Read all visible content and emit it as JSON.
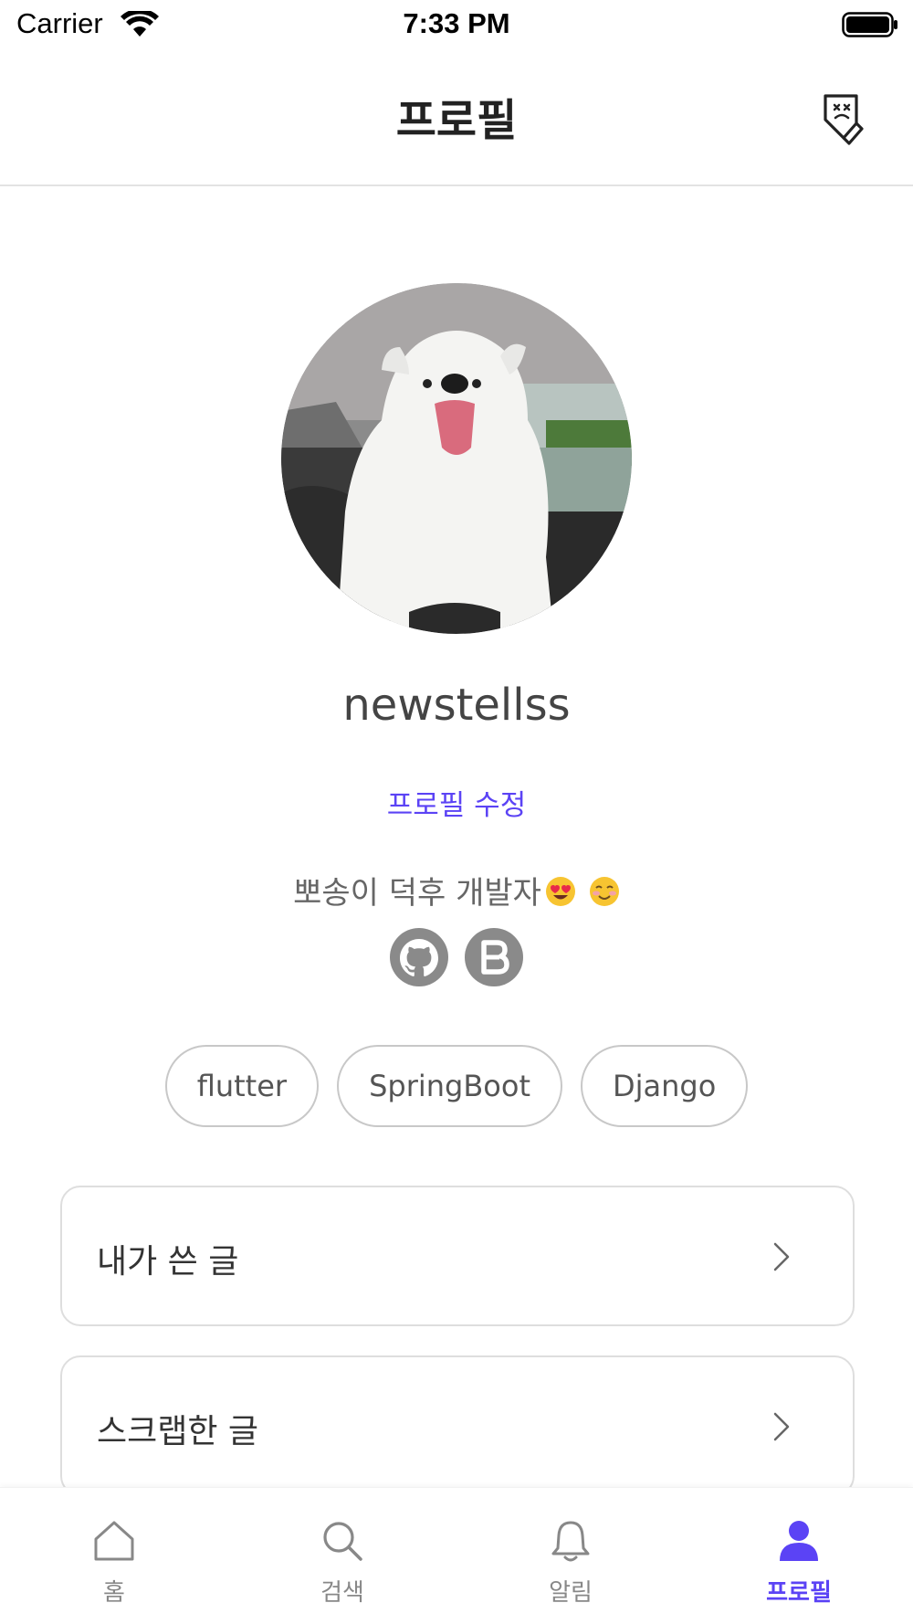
{
  "status_bar": {
    "carrier": "Carrier",
    "time": "7:33 PM"
  },
  "header": {
    "title": "프로필"
  },
  "profile": {
    "username": "newstellss",
    "edit_label": "프로필 수정",
    "bio": "뽀송이 덕후 개발자",
    "social_links": [
      "github-icon",
      "blog-icon"
    ],
    "tags": [
      "flutter",
      "SpringBoot",
      "Django"
    ]
  },
  "menu": {
    "my_posts": "내가 쓴 글",
    "scrapped_posts": "스크랩한 글"
  },
  "bottom_nav": {
    "items": [
      {
        "label": "홈",
        "icon": "home-icon"
      },
      {
        "label": "검색",
        "icon": "search-icon"
      },
      {
        "label": "알림",
        "icon": "bell-icon"
      },
      {
        "label": "프로필",
        "icon": "person-icon"
      }
    ],
    "active_index": 3
  },
  "colors": {
    "accent": "#5b43f5",
    "inactive": "#888888",
    "border": "#dedede"
  }
}
